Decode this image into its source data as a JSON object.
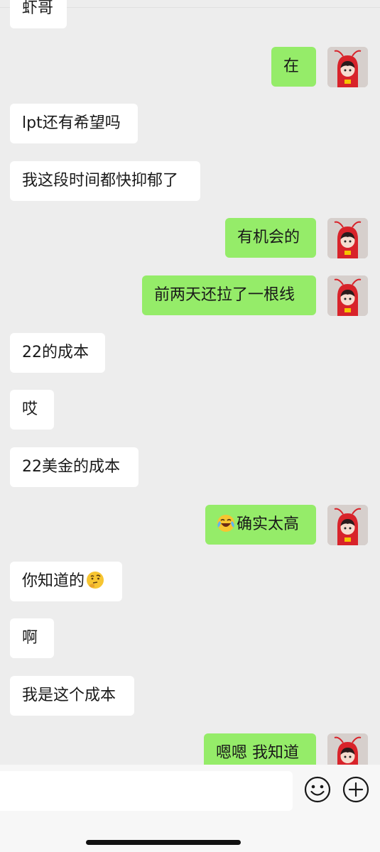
{
  "messages": [
    {
      "side": "recv",
      "text": "虾哥"
    },
    {
      "side": "sent",
      "text": "在"
    },
    {
      "side": "recv",
      "text": "lpt还有希望吗"
    },
    {
      "side": "recv",
      "text": "我这段时间都快抑郁了"
    },
    {
      "side": "sent",
      "text": "有机会的"
    },
    {
      "side": "sent",
      "text": "前两天还拉了一根线"
    },
    {
      "side": "recv",
      "text": "22的成本"
    },
    {
      "side": "recv",
      "text": "哎"
    },
    {
      "side": "recv",
      "text": "22美金的成本"
    },
    {
      "side": "sent",
      "text": "确实太高",
      "emoji_before": "laughing-crying-emoji"
    },
    {
      "side": "recv",
      "text": "你知道的",
      "emoji_after": "thinking-face-emoji"
    },
    {
      "side": "recv",
      "text": "啊"
    },
    {
      "side": "recv",
      "text": "我是这个成本"
    },
    {
      "side": "sent",
      "text": "嗯嗯 我知道"
    }
  ],
  "input_bar": {
    "text_value": "",
    "emoji_icon": "smiley-face-icon",
    "plus_icon": "plus-circle-icon"
  },
  "colors": {
    "background": "#ededed",
    "sent_bubble": "#95ec69",
    "received_bubble": "#ffffff"
  }
}
